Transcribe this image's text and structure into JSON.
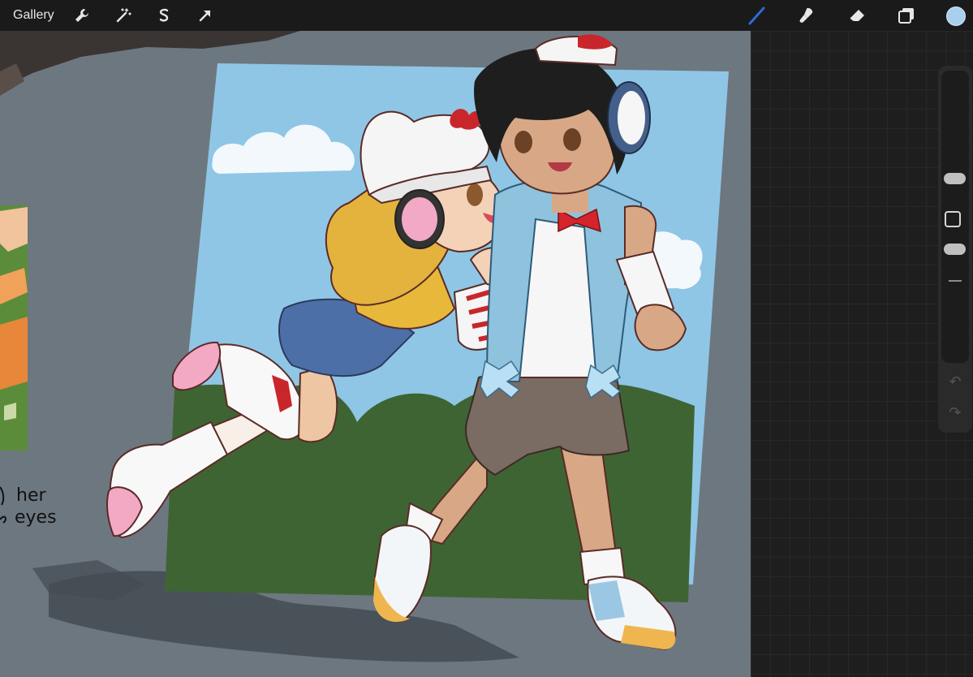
{
  "toolbar": {
    "gallery_label": "Gallery",
    "left_tools": [
      "wrench-icon",
      "magic-wand-icon",
      "selection-icon",
      "transform-arrow-icon"
    ],
    "right_tools": [
      "brush-icon",
      "smudge-icon",
      "eraser-icon",
      "layers-icon"
    ],
    "current_color": "#a7d0ee",
    "accent_color": "#2b6cd8"
  },
  "canvas": {
    "handwritten_note_lines": [
      "her",
      "eyes"
    ]
  },
  "sidebar": {
    "controls": [
      "brush-size-slider",
      "modify-button",
      "opacity-slider",
      "undo-icon",
      "redo-icon"
    ]
  }
}
